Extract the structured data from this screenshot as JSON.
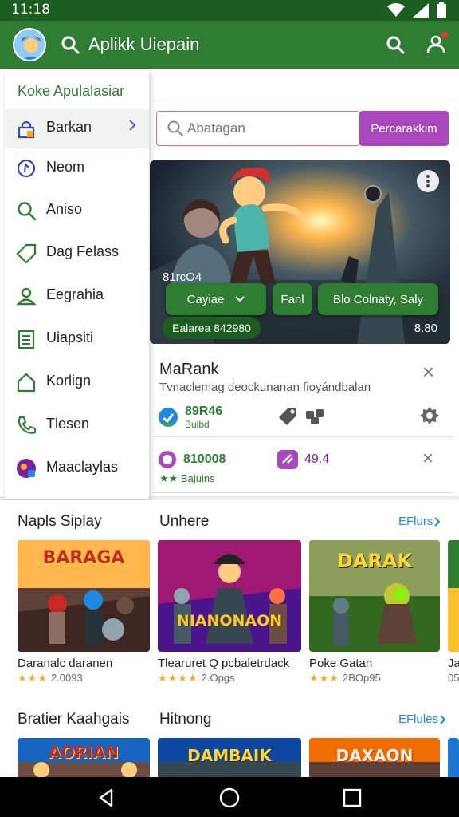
{
  "status": {
    "time": "11:18"
  },
  "appbar": {
    "title": "Aplikk Uiepain"
  },
  "search": {
    "placeholder": "Abatagan",
    "button_label": "Percarakkim"
  },
  "drawer": {
    "title": "Koke Apulalasiar",
    "items": [
      {
        "label": "Barkan",
        "icon": "lock-icon",
        "active": true
      },
      {
        "label": "Neom",
        "icon": "circle-icon"
      },
      {
        "label": "Aniso",
        "icon": "search-icon"
      },
      {
        "label": "Dag Felass",
        "icon": "tag-icon"
      },
      {
        "label": "Eegrahia",
        "icon": "person-icon"
      },
      {
        "label": "Uiapsiti",
        "icon": "document-icon"
      },
      {
        "label": "Korlign",
        "icon": "home-icon"
      },
      {
        "label": "Tlesen",
        "icon": "phone-icon"
      },
      {
        "label": "Maaclaylas",
        "icon": "app-icon"
      }
    ]
  },
  "hero": {
    "value": "81rcO4",
    "category_label": "Cayiae",
    "button_2": "Fanl",
    "button_3": "Blo Colnaty, Saly",
    "badge": "Ealarea 842980",
    "number": "8.80"
  },
  "rank_card": {
    "title": "MaRank",
    "subtitle": "Tvnaclemag deockunanan fioyándbalan",
    "stat_value": "89R46",
    "stat_label": "Bulbd"
  },
  "row2": {
    "value": "810008",
    "sublabel": "Bajuins",
    "value2": "49.4"
  },
  "sections": [
    {
      "title": "Napls Siplay",
      "title2": "Unhere",
      "more": "EFlurs"
    },
    {
      "title": "Bratier Kaahgais",
      "title2": "Hitnong",
      "more": "EFlules"
    }
  ],
  "games_row1": [
    {
      "thumb_text": "BARAGA",
      "name": "Daranalc daranen",
      "rating": "2.0093"
    },
    {
      "thumb_text": "NIANONAON",
      "name": "Tlearuret Q pcbaletrdack",
      "rating": "2.Opgs"
    },
    {
      "thumb_text": "DARAK",
      "name": "Poke Gatan",
      "rating": "2BOp95"
    },
    {
      "name": "Ja",
      "rating": "05"
    }
  ],
  "games_row2": [
    {
      "thumb_text": "AORIAN"
    },
    {
      "thumb_text": "DAMBAIK"
    },
    {
      "thumb_text": "DAXAON"
    }
  ],
  "colors": {
    "primary": "#2e7d32",
    "primary_dark": "#1b5e20",
    "accent": "#ab47bc",
    "link": "#1e88e5"
  }
}
